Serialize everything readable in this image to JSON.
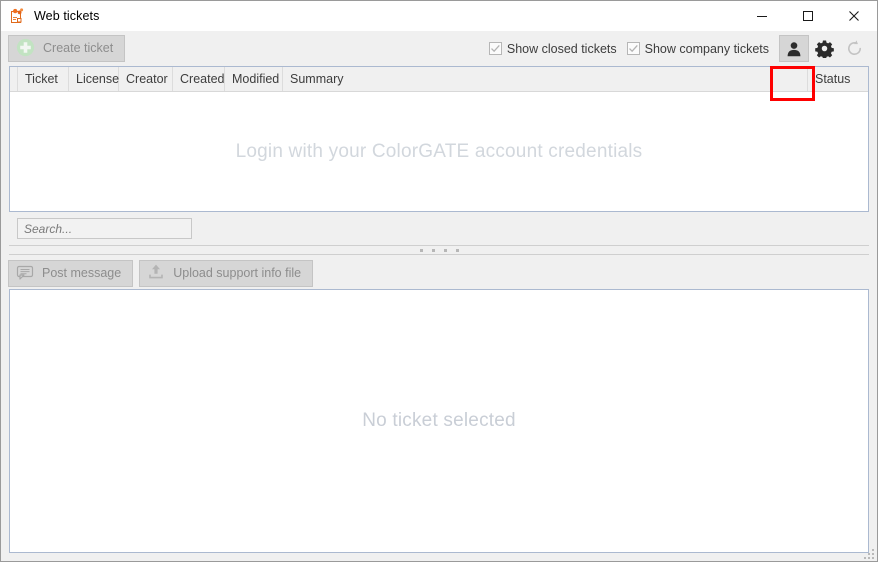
{
  "window": {
    "title": "Web tickets",
    "app_icon": "web-tickets-icon",
    "controls": {
      "minimize": "minimize-icon",
      "maximize": "maximize-icon",
      "close": "close-icon"
    }
  },
  "toolbar": {
    "create_ticket_label": "Create ticket",
    "create_ticket_icon": "plus-circle-icon",
    "checkboxes": [
      {
        "label": "Show closed tickets",
        "checked": true
      },
      {
        "label": "Show company tickets",
        "checked": true
      }
    ],
    "icon_buttons": [
      {
        "name": "account-button",
        "icon": "person-icon",
        "highlighted": true
      },
      {
        "name": "settings-button",
        "icon": "gear-icon",
        "highlighted": false
      },
      {
        "name": "refresh-button",
        "icon": "refresh-icon",
        "highlighted": false
      }
    ],
    "highlight_color": "#fe0000"
  },
  "ticket_table": {
    "columns": [
      "Ticket",
      "License",
      "Creator",
      "Created",
      "Modified",
      "Summary"
    ],
    "status_column": "Status",
    "rows": [],
    "empty_message": "Login with your ColorGATE account credentials"
  },
  "search": {
    "value": "",
    "placeholder": "Search..."
  },
  "splitter": {
    "name": "pane-splitter",
    "dots": 4
  },
  "detail_toolbar": {
    "post_message_label": "Post message",
    "post_message_icon": "message-icon",
    "upload_label": "Upload support info file",
    "upload_icon": "upload-icon"
  },
  "detail_pane": {
    "empty_message": "No ticket selected"
  }
}
